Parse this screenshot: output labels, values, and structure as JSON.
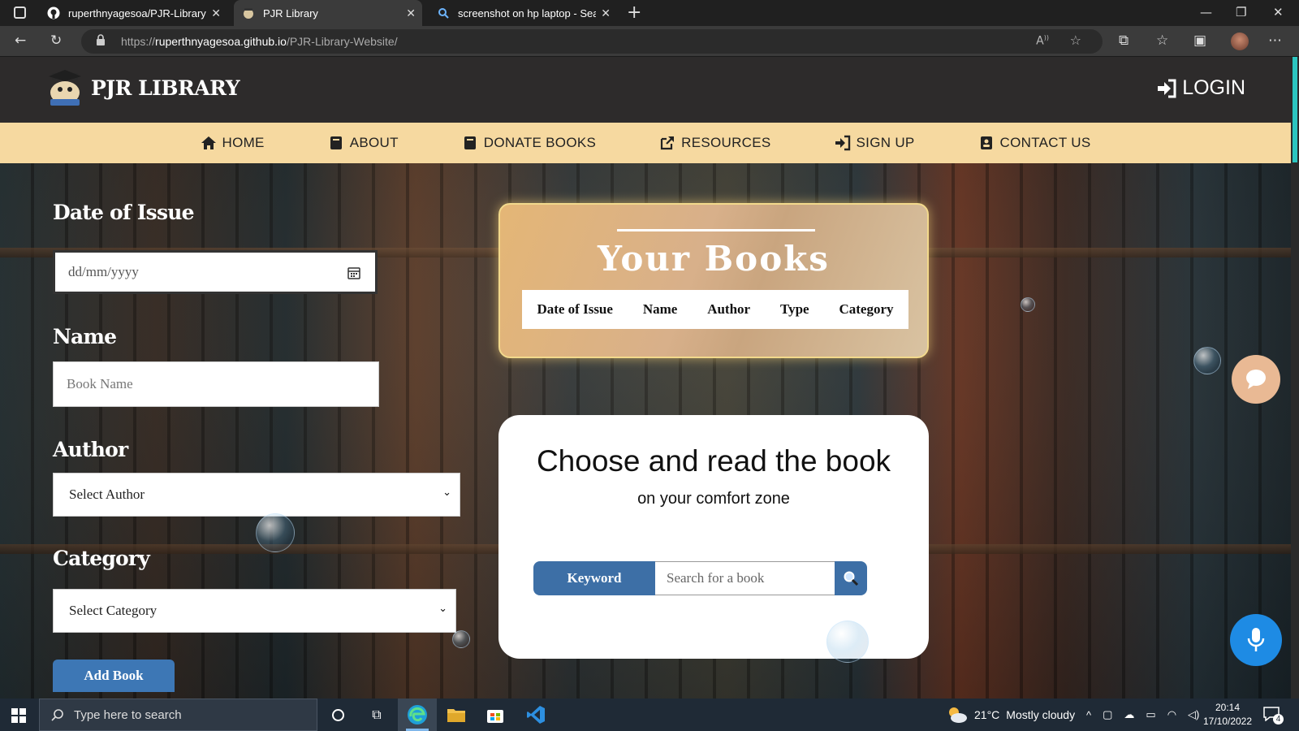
{
  "browser": {
    "tabs": [
      {
        "label": "ruperthnyagesoa/PJR-Library-We",
        "icon": "github-icon"
      },
      {
        "label": "PJR Library",
        "icon": "site-logo-icon"
      },
      {
        "label": "screenshot on hp laptop - Search",
        "icon": "search-icon"
      }
    ],
    "url_prefix": "https://",
    "url_host": "ruperthnyagesoa.github.io",
    "url_path": "/PJR-Library-Website/"
  },
  "site": {
    "brand": "PJR LIBRARY",
    "login": "LOGIN",
    "nav": [
      {
        "label": "HOME",
        "icon": "home-icon"
      },
      {
        "label": "ABOUT",
        "icon": "book-icon"
      },
      {
        "label": "DONATE BOOKS",
        "icon": "book-icon"
      },
      {
        "label": "RESOURCES",
        "icon": "external-link-icon"
      },
      {
        "label": "SIGN UP",
        "icon": "sign-in-icon"
      },
      {
        "label": "CONTACT US",
        "icon": "contact-icon"
      }
    ]
  },
  "form": {
    "date_label": "Date of Issue",
    "date_placeholder": "dd/mm/yyyy",
    "name_label": "Name",
    "name_placeholder": "Book Name",
    "author_label": "Author",
    "author_selected": "Select Author",
    "category_label": "Category",
    "category_selected": "Select Category",
    "add_button": "Add Book"
  },
  "books": {
    "title": "Your Books",
    "columns": [
      "Date of Issue",
      "Name",
      "Author",
      "Type",
      "Category"
    ]
  },
  "search": {
    "title": "Choose and read the book",
    "subtitle": "on your comfort zone",
    "keyword_label": "Keyword",
    "placeholder": "Search for a book"
  },
  "taskbar": {
    "search_placeholder": "Type here to search",
    "weather_temp": "21°C",
    "weather_desc": "Mostly cloudy",
    "time": "20:14",
    "date": "17/10/2022",
    "notification_count": "4"
  }
}
